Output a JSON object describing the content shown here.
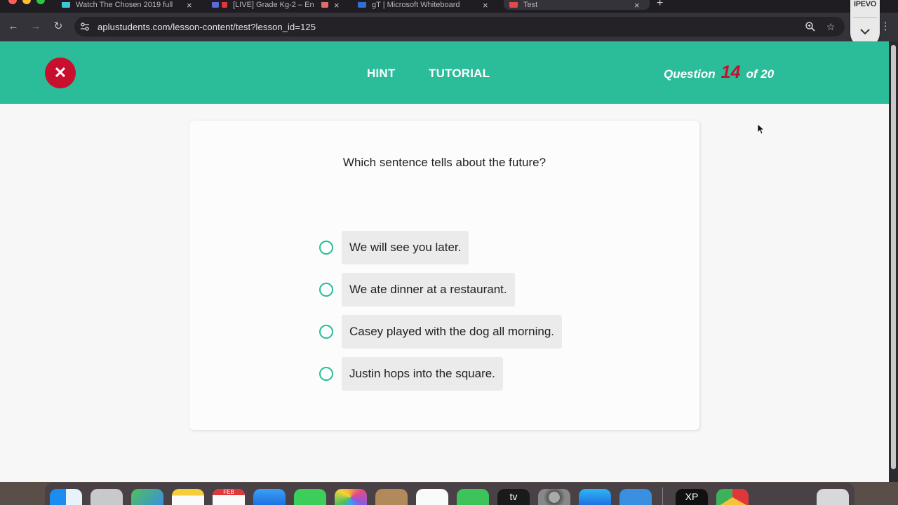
{
  "browser": {
    "tabs": [
      {
        "label": "Watch The Chosen 2019 full",
        "favicon_color": "#3fc7d6",
        "active": false
      },
      {
        "label": "[LIVE] Grade Kg-2 – En",
        "favicon_color": "#5a6ad6",
        "active": false
      },
      {
        "label": "gT | Microsoft Whiteboard",
        "favicon_color": "#2f6fd6",
        "active": false
      },
      {
        "label": "Test",
        "favicon_color": "#e04a4a",
        "active": true
      }
    ],
    "new_tab_label": "+",
    "url": "aplustudents.com/lesson-content/test?lesson_id=125"
  },
  "overlay": {
    "brand": "IPEVO"
  },
  "header": {
    "hint_label": "HINT",
    "tutorial_label": "TUTORIAL",
    "question_prefix": "Question",
    "question_number": "14",
    "question_suffix": "of 20",
    "close_symbol": "✕"
  },
  "quiz": {
    "question": "Which sentence tells about the future?",
    "options": [
      "We will see you later.",
      "We ate dinner at a restaurant.",
      "Casey played with the dog all morning.",
      "Justin hops into the square."
    ]
  },
  "dock": {
    "calendar_month": "FEB",
    "tv_label": "tv",
    "xp_label": "XP"
  },
  "colors": {
    "accent": "#2bbc9a",
    "danger": "#c8102e"
  }
}
